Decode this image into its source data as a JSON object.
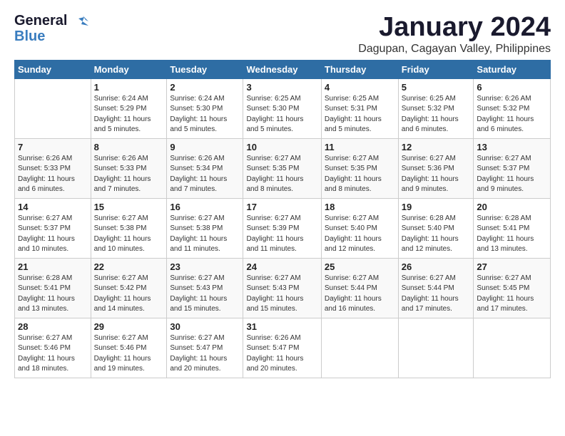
{
  "logo": {
    "line1": "General",
    "line2": "Blue"
  },
  "title": "January 2024",
  "subtitle": "Dagupan, Cagayan Valley, Philippines",
  "weekdays": [
    "Sunday",
    "Monday",
    "Tuesday",
    "Wednesday",
    "Thursday",
    "Friday",
    "Saturday"
  ],
  "weeks": [
    [
      {
        "day": "",
        "info": ""
      },
      {
        "day": "1",
        "info": "Sunrise: 6:24 AM\nSunset: 5:29 PM\nDaylight: 11 hours\nand 5 minutes."
      },
      {
        "day": "2",
        "info": "Sunrise: 6:24 AM\nSunset: 5:30 PM\nDaylight: 11 hours\nand 5 minutes."
      },
      {
        "day": "3",
        "info": "Sunrise: 6:25 AM\nSunset: 5:30 PM\nDaylight: 11 hours\nand 5 minutes."
      },
      {
        "day": "4",
        "info": "Sunrise: 6:25 AM\nSunset: 5:31 PM\nDaylight: 11 hours\nand 5 minutes."
      },
      {
        "day": "5",
        "info": "Sunrise: 6:25 AM\nSunset: 5:32 PM\nDaylight: 11 hours\nand 6 minutes."
      },
      {
        "day": "6",
        "info": "Sunrise: 6:26 AM\nSunset: 5:32 PM\nDaylight: 11 hours\nand 6 minutes."
      }
    ],
    [
      {
        "day": "7",
        "info": "Sunrise: 6:26 AM\nSunset: 5:33 PM\nDaylight: 11 hours\nand 6 minutes."
      },
      {
        "day": "8",
        "info": "Sunrise: 6:26 AM\nSunset: 5:33 PM\nDaylight: 11 hours\nand 7 minutes."
      },
      {
        "day": "9",
        "info": "Sunrise: 6:26 AM\nSunset: 5:34 PM\nDaylight: 11 hours\nand 7 minutes."
      },
      {
        "day": "10",
        "info": "Sunrise: 6:27 AM\nSunset: 5:35 PM\nDaylight: 11 hours\nand 8 minutes."
      },
      {
        "day": "11",
        "info": "Sunrise: 6:27 AM\nSunset: 5:35 PM\nDaylight: 11 hours\nand 8 minutes."
      },
      {
        "day": "12",
        "info": "Sunrise: 6:27 AM\nSunset: 5:36 PM\nDaylight: 11 hours\nand 9 minutes."
      },
      {
        "day": "13",
        "info": "Sunrise: 6:27 AM\nSunset: 5:37 PM\nDaylight: 11 hours\nand 9 minutes."
      }
    ],
    [
      {
        "day": "14",
        "info": "Sunrise: 6:27 AM\nSunset: 5:37 PM\nDaylight: 11 hours\nand 10 minutes."
      },
      {
        "day": "15",
        "info": "Sunrise: 6:27 AM\nSunset: 5:38 PM\nDaylight: 11 hours\nand 10 minutes."
      },
      {
        "day": "16",
        "info": "Sunrise: 6:27 AM\nSunset: 5:38 PM\nDaylight: 11 hours\nand 11 minutes."
      },
      {
        "day": "17",
        "info": "Sunrise: 6:27 AM\nSunset: 5:39 PM\nDaylight: 11 hours\nand 11 minutes."
      },
      {
        "day": "18",
        "info": "Sunrise: 6:27 AM\nSunset: 5:40 PM\nDaylight: 11 hours\nand 12 minutes."
      },
      {
        "day": "19",
        "info": "Sunrise: 6:28 AM\nSunset: 5:40 PM\nDaylight: 11 hours\nand 12 minutes."
      },
      {
        "day": "20",
        "info": "Sunrise: 6:28 AM\nSunset: 5:41 PM\nDaylight: 11 hours\nand 13 minutes."
      }
    ],
    [
      {
        "day": "21",
        "info": "Sunrise: 6:28 AM\nSunset: 5:41 PM\nDaylight: 11 hours\nand 13 minutes."
      },
      {
        "day": "22",
        "info": "Sunrise: 6:27 AM\nSunset: 5:42 PM\nDaylight: 11 hours\nand 14 minutes."
      },
      {
        "day": "23",
        "info": "Sunrise: 6:27 AM\nSunset: 5:43 PM\nDaylight: 11 hours\nand 15 minutes."
      },
      {
        "day": "24",
        "info": "Sunrise: 6:27 AM\nSunset: 5:43 PM\nDaylight: 11 hours\nand 15 minutes."
      },
      {
        "day": "25",
        "info": "Sunrise: 6:27 AM\nSunset: 5:44 PM\nDaylight: 11 hours\nand 16 minutes."
      },
      {
        "day": "26",
        "info": "Sunrise: 6:27 AM\nSunset: 5:44 PM\nDaylight: 11 hours\nand 17 minutes."
      },
      {
        "day": "27",
        "info": "Sunrise: 6:27 AM\nSunset: 5:45 PM\nDaylight: 11 hours\nand 17 minutes."
      }
    ],
    [
      {
        "day": "28",
        "info": "Sunrise: 6:27 AM\nSunset: 5:46 PM\nDaylight: 11 hours\nand 18 minutes."
      },
      {
        "day": "29",
        "info": "Sunrise: 6:27 AM\nSunset: 5:46 PM\nDaylight: 11 hours\nand 19 minutes."
      },
      {
        "day": "30",
        "info": "Sunrise: 6:27 AM\nSunset: 5:47 PM\nDaylight: 11 hours\nand 20 minutes."
      },
      {
        "day": "31",
        "info": "Sunrise: 6:26 AM\nSunset: 5:47 PM\nDaylight: 11 hours\nand 20 minutes."
      },
      {
        "day": "",
        "info": ""
      },
      {
        "day": "",
        "info": ""
      },
      {
        "day": "",
        "info": ""
      }
    ]
  ]
}
